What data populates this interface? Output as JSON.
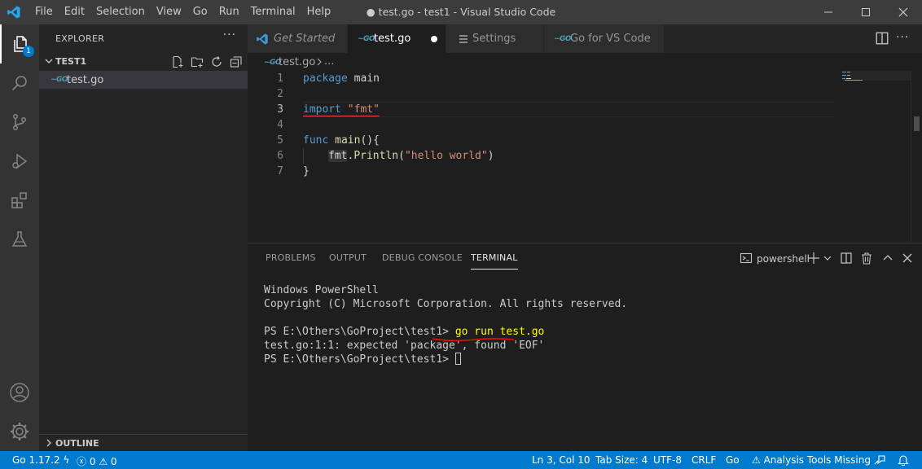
{
  "titlebar": {
    "menu": [
      "File",
      "Edit",
      "Selection",
      "View",
      "Go",
      "Run",
      "Terminal",
      "Help"
    ],
    "title": "● test.go - test1 - Visual Studio Code"
  },
  "activity_bar": {
    "explorer_badge": "1"
  },
  "sidebar": {
    "header": "EXPLORER",
    "more": "···",
    "folder": "TEST1",
    "files": [
      "test.go"
    ],
    "outline": "OUTLINE"
  },
  "tabs": [
    {
      "label": "Get Started",
      "icon": "vscode-icon"
    },
    {
      "label": "test.go",
      "icon": "go-icon",
      "modified": true
    },
    {
      "label": "Settings",
      "icon": "settings-list-icon"
    },
    {
      "label": "Go for VS Code",
      "icon": "go-icon"
    }
  ],
  "breadcrumb": {
    "file": "test.go",
    "more": "..."
  },
  "editor": {
    "line_numbers": [
      "1",
      "2",
      "3",
      "4",
      "5",
      "6",
      "7"
    ],
    "current_line": 3,
    "tokens": {
      "l1_kw": "package",
      "l1_name": " main",
      "l3_kw": "import",
      "l3_str": "\"fmt\"",
      "l5_kw": "func",
      "l5_fn": " main",
      "l5_rest": "(){",
      "l6_pkg": "fmt",
      "l6_dot": ".",
      "l6_fn": "Println",
      "l6_open": "(",
      "l6_str": "\"hello world\"",
      "l6_close": ")",
      "l7": "}"
    }
  },
  "panel": {
    "tabs": [
      "PROBLEMS",
      "OUTPUT",
      "DEBUG CONSOLE",
      "TERMINAL"
    ],
    "active_tab": "TERMINAL",
    "shell": "powershell",
    "terminal": {
      "line1": "Windows PowerShell",
      "line2": "Copyright (C) Microsoft Corporation. All rights reserved.",
      "prompt1": "PS E:\\Others\\GoProject\\test1> ",
      "command": "go run test.go",
      "error": "test.go:1:1: expected 'package', found 'EOF'",
      "prompt2": "PS E:\\Others\\GoProject\\test1> "
    }
  },
  "statusbar": {
    "go_version": "Go 1.17.2",
    "errors": "0",
    "warnings": "0",
    "position": "Ln 3, Col 10",
    "tab_size": "Tab Size: 4",
    "encoding": "UTF-8",
    "eol": "CRLF",
    "language": "Go",
    "analysis": "Analysis Tools Missing"
  },
  "colors": {
    "accent": "#007acc",
    "go_icon": "#519aba",
    "keyword": "#569cd6",
    "function": "#dcdcaa",
    "string": "#ce9178"
  }
}
